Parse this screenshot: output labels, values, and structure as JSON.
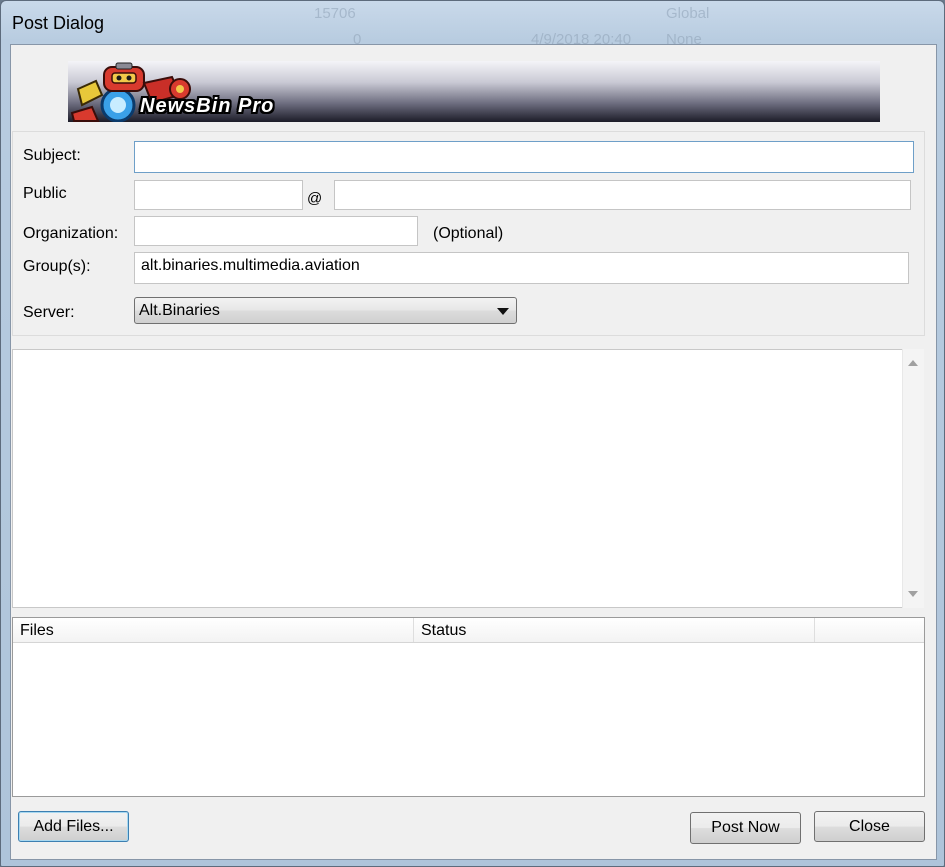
{
  "window": {
    "title": "Post Dialog",
    "background_rows": [
      "15706",
      "Global",
      "0",
      "4/9/2018 20:40",
      "None"
    ]
  },
  "banner": {
    "logo_text": "NewsBin Pro"
  },
  "form": {
    "subject_label": "Subject:",
    "subject_value": "",
    "public_label": "Public",
    "public_name_value": "",
    "at_symbol": "@",
    "public_domain_value": "",
    "organization_label": "Organization:",
    "organization_value": "",
    "optional_note": "(Optional)",
    "groups_label": "Group(s):",
    "groups_value": "alt.binaries.multimedia.aviation",
    "server_label": "Server:",
    "server_selected": "Alt.Binaries"
  },
  "body_text": "",
  "files_list": {
    "columns": [
      "Files",
      "Status",
      ""
    ],
    "rows": []
  },
  "buttons": {
    "add_files": "Add Files...",
    "post_now": "Post Now",
    "close": "Close"
  },
  "colors": {
    "dialog_bg": "#f0f0f0",
    "focus_border": "#6e9fc8",
    "default_button_border": "#3c7fb1"
  }
}
